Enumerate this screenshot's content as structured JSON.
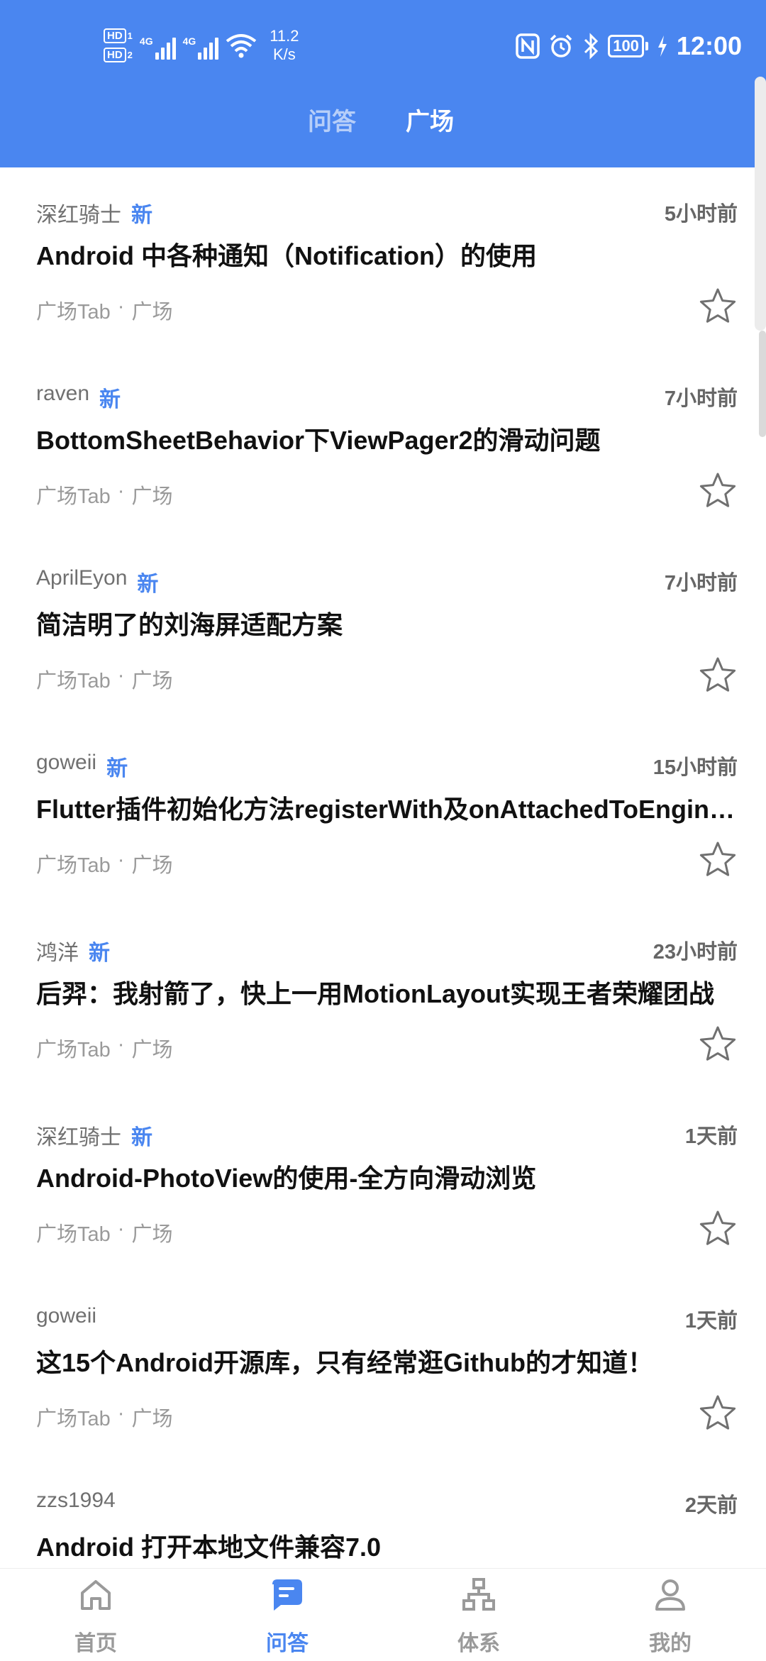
{
  "status_bar": {
    "hd1": "HD",
    "hd1_num": "1",
    "hd2": "HD",
    "hd2_num": "2",
    "net1": "4G",
    "net2": "4G",
    "speed_value": "11.2",
    "speed_unit": "K/s",
    "battery": "100",
    "time": "12:00"
  },
  "header": {
    "tabs": [
      {
        "label": "问答",
        "active": false
      },
      {
        "label": "广场",
        "active": true
      }
    ]
  },
  "feed": {
    "items": [
      {
        "author": "深红骑士",
        "new_badge": "新",
        "time": "5小时前",
        "title": "Android 中各种通知（Notification）的使用",
        "tab_label": "广场Tab",
        "separator": "·",
        "category": "广场"
      },
      {
        "author": "raven",
        "new_badge": "新",
        "time": "7小时前",
        "title": "BottomSheetBehavior下ViewPager2的滑动问题",
        "tab_label": "广场Tab",
        "separator": "·",
        "category": "广场"
      },
      {
        "author": "AprilEyon",
        "new_badge": "新",
        "time": "7小时前",
        "title": "简洁明了的刘海屏适配方案",
        "tab_label": "广场Tab",
        "separator": "·",
        "category": "广场"
      },
      {
        "author": "goweii",
        "new_badge": "新",
        "time": "15小时前",
        "title": "Flutter插件初始化方法registerWith及onAttachedToEngine…",
        "tab_label": "广场Tab",
        "separator": "·",
        "category": "广场"
      },
      {
        "author": "鸿洋",
        "new_badge": "新",
        "time": "23小时前",
        "title": "后羿：我射箭了，快上一用MotionLayout实现王者荣耀团战",
        "tab_label": "广场Tab",
        "separator": "·",
        "category": "广场"
      },
      {
        "author": "深红骑士",
        "new_badge": "新",
        "time": "1天前",
        "title": "Android-PhotoView的使用-全方向滑动浏览",
        "tab_label": "广场Tab",
        "separator": "·",
        "category": "广场"
      },
      {
        "author": "goweii",
        "new_badge": "",
        "time": "1天前",
        "title": "这15个Android开源库，只有经常逛Github的才知道！",
        "tab_label": "广场Tab",
        "separator": "·",
        "category": "广场"
      },
      {
        "author": "zzs1994",
        "new_badge": "",
        "time": "2天前",
        "title": "Android 打开本地文件兼容7.0",
        "tab_label": "",
        "separator": "",
        "category": ""
      }
    ]
  },
  "bottom_nav": {
    "items": [
      {
        "label": "首页",
        "icon": "home-icon",
        "active": false
      },
      {
        "label": "问答",
        "icon": "chat-icon",
        "active": true
      },
      {
        "label": "体系",
        "icon": "hierarchy-icon",
        "active": false
      },
      {
        "label": "我的",
        "icon": "user-icon",
        "active": false
      }
    ]
  },
  "colors": {
    "accent": "#4a86f0",
    "header_bg": "#4a86f0",
    "text_primary": "#111111",
    "text_secondary": "#707070"
  }
}
